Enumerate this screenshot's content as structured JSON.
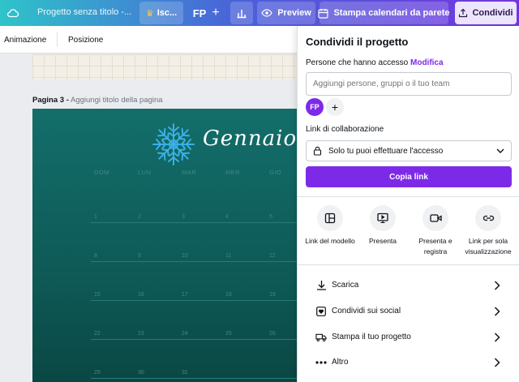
{
  "topbar": {
    "project_title": "Progetto senza titolo -...",
    "upgrade_label": "Isc...",
    "avatar_initials": "FP",
    "add_label": "+",
    "preview_label": "Preview",
    "print_calendar_label": "Stampa calendari da parete",
    "share_label": "Condividi"
  },
  "subbar": {
    "animation_label": "Animazione",
    "position_label": "Posizione"
  },
  "canvas": {
    "page_number": "Pagina 3 -",
    "page_title_placeholder": "Aggiungi titolo della pagina",
    "month": "Gennaio",
    "weekdays": [
      "DOM",
      "LUN",
      "MAR",
      "MER",
      "GIO"
    ],
    "day_rows": [
      [
        "1",
        "2",
        "3",
        "4",
        "5"
      ],
      [
        "8",
        "9",
        "10",
        "11",
        "12"
      ],
      [
        "15",
        "16",
        "17",
        "18",
        "19"
      ],
      [
        "22",
        "23",
        "24",
        "25",
        "26"
      ],
      [
        "29",
        "30",
        "31",
        "",
        ""
      ]
    ]
  },
  "share_panel": {
    "title": "Condividi il progetto",
    "people_access_label": "Persone che hanno accesso",
    "edit_link": "Modifica",
    "add_people_placeholder": "Aggiungi persone, gruppi o il tuo team",
    "member_initials": "FP",
    "collab_link_label": "Link di collaborazione",
    "access_option": "Solo tu puoi effettuare l'accesso",
    "copy_link_button": "Copia link",
    "quick_options": [
      {
        "label": "Link del modello",
        "icon": "template-icon"
      },
      {
        "label": "Presenta",
        "icon": "present-icon"
      },
      {
        "label": "Presenta e registra",
        "icon": "record-icon"
      },
      {
        "label": "Link per sola visualizzazione",
        "icon": "link-icon"
      }
    ],
    "menu": [
      {
        "label": "Scarica",
        "icon": "download-icon"
      },
      {
        "label": "Condividi sui social",
        "icon": "social-icon"
      },
      {
        "label": "Stampa il tuo progetto",
        "icon": "truck-icon"
      },
      {
        "label": "Altro",
        "icon": "more-icon"
      }
    ],
    "accent_color": "#7d2ae8"
  }
}
